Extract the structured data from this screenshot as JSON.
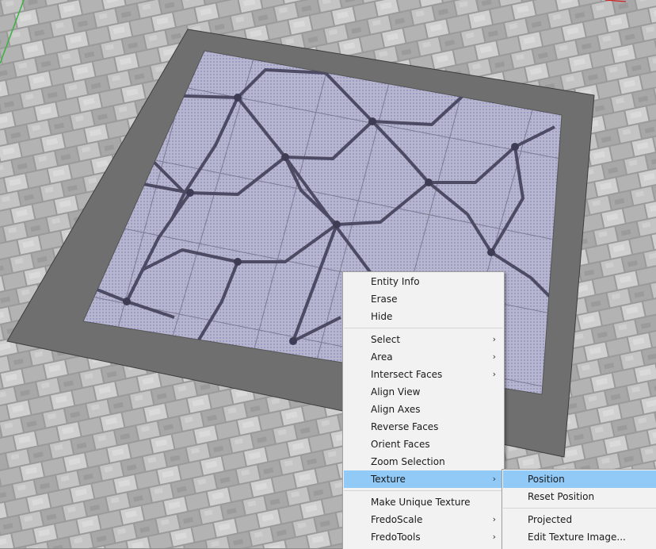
{
  "scene": {
    "background_color": "#8c8c8c",
    "frame_color": "#6f6f6f",
    "tile_fill_color": "#b7b6cf",
    "pattern_line_color": "#4d4b63",
    "axis_green": "#3cb043",
    "axis_red": "#d02020"
  },
  "context_menu": {
    "items": [
      {
        "label": "Entity Info"
      },
      {
        "label": "Erase"
      },
      {
        "label": "Hide"
      },
      {
        "label": "Select",
        "arrow": "›"
      },
      {
        "label": "Area",
        "arrow": "›"
      },
      {
        "label": "Intersect Faces",
        "arrow": "›"
      },
      {
        "label": "Align View"
      },
      {
        "label": "Align Axes"
      },
      {
        "label": "Reverse Faces"
      },
      {
        "label": "Orient Faces"
      },
      {
        "label": "Zoom Selection"
      },
      {
        "label": "Texture",
        "arrow": "›",
        "highlighted": true
      },
      {
        "label": "Make Unique Texture"
      },
      {
        "label": "FredoScale",
        "arrow": "›"
      },
      {
        "label": "FredoTools",
        "arrow": "›"
      }
    ]
  },
  "texture_submenu": {
    "items": [
      {
        "label": "Position",
        "highlighted": true
      },
      {
        "label": "Reset Position"
      },
      {
        "label": "Projected"
      },
      {
        "label": "Edit Texture Image..."
      }
    ]
  }
}
